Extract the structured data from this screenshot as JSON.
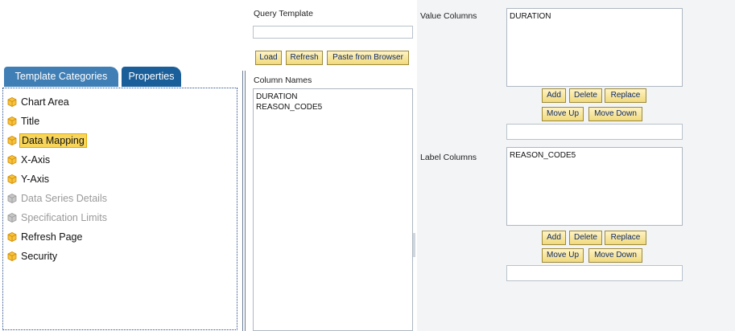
{
  "tabs": {
    "active": "Template Categories",
    "inactive": "Properties"
  },
  "categories": [
    {
      "label": "Chart Area",
      "state": "enabled"
    },
    {
      "label": "Title",
      "state": "enabled"
    },
    {
      "label": "Data Mapping",
      "state": "selected"
    },
    {
      "label": "X-Axis",
      "state": "enabled"
    },
    {
      "label": "Y-Axis",
      "state": "enabled"
    },
    {
      "label": "Data Series Details",
      "state": "disabled"
    },
    {
      "label": "Specification Limits",
      "state": "disabled"
    },
    {
      "label": "Refresh Page",
      "state": "enabled"
    },
    {
      "label": "Security",
      "state": "enabled"
    }
  ],
  "query": {
    "template_label": "Query Template",
    "template_value": "",
    "buttons": {
      "load": "Load",
      "refresh": "Refresh",
      "paste": "Paste from Browser"
    },
    "column_names_label": "Column Names",
    "column_names": [
      "DURATION",
      "REASON_CODE5"
    ]
  },
  "value_columns": {
    "label": "Value Columns",
    "items": [
      "DURATION"
    ],
    "buttons": {
      "add": "Add",
      "delete": "Delete",
      "replace": "Replace",
      "move_up": "Move Up",
      "move_down": "Move Down"
    },
    "input_value": ""
  },
  "label_columns": {
    "label": "Label Columns",
    "items": [
      "REASON_CODE5"
    ],
    "buttons": {
      "add": "Add",
      "delete": "Delete",
      "replace": "Replace",
      "move_up": "Move Up",
      "move_down": "Move Down"
    },
    "input_value": ""
  },
  "colors": {
    "tab_active": "#3f7fb6",
    "tab_inactive": "#1a5f9a",
    "selected": "#f7d55a",
    "button": "#f1da7e",
    "panel_border": "#2b4e8a"
  },
  "icons": {
    "category_enabled": "gold-cube-icon",
    "category_disabled": "gray-cube-icon"
  }
}
